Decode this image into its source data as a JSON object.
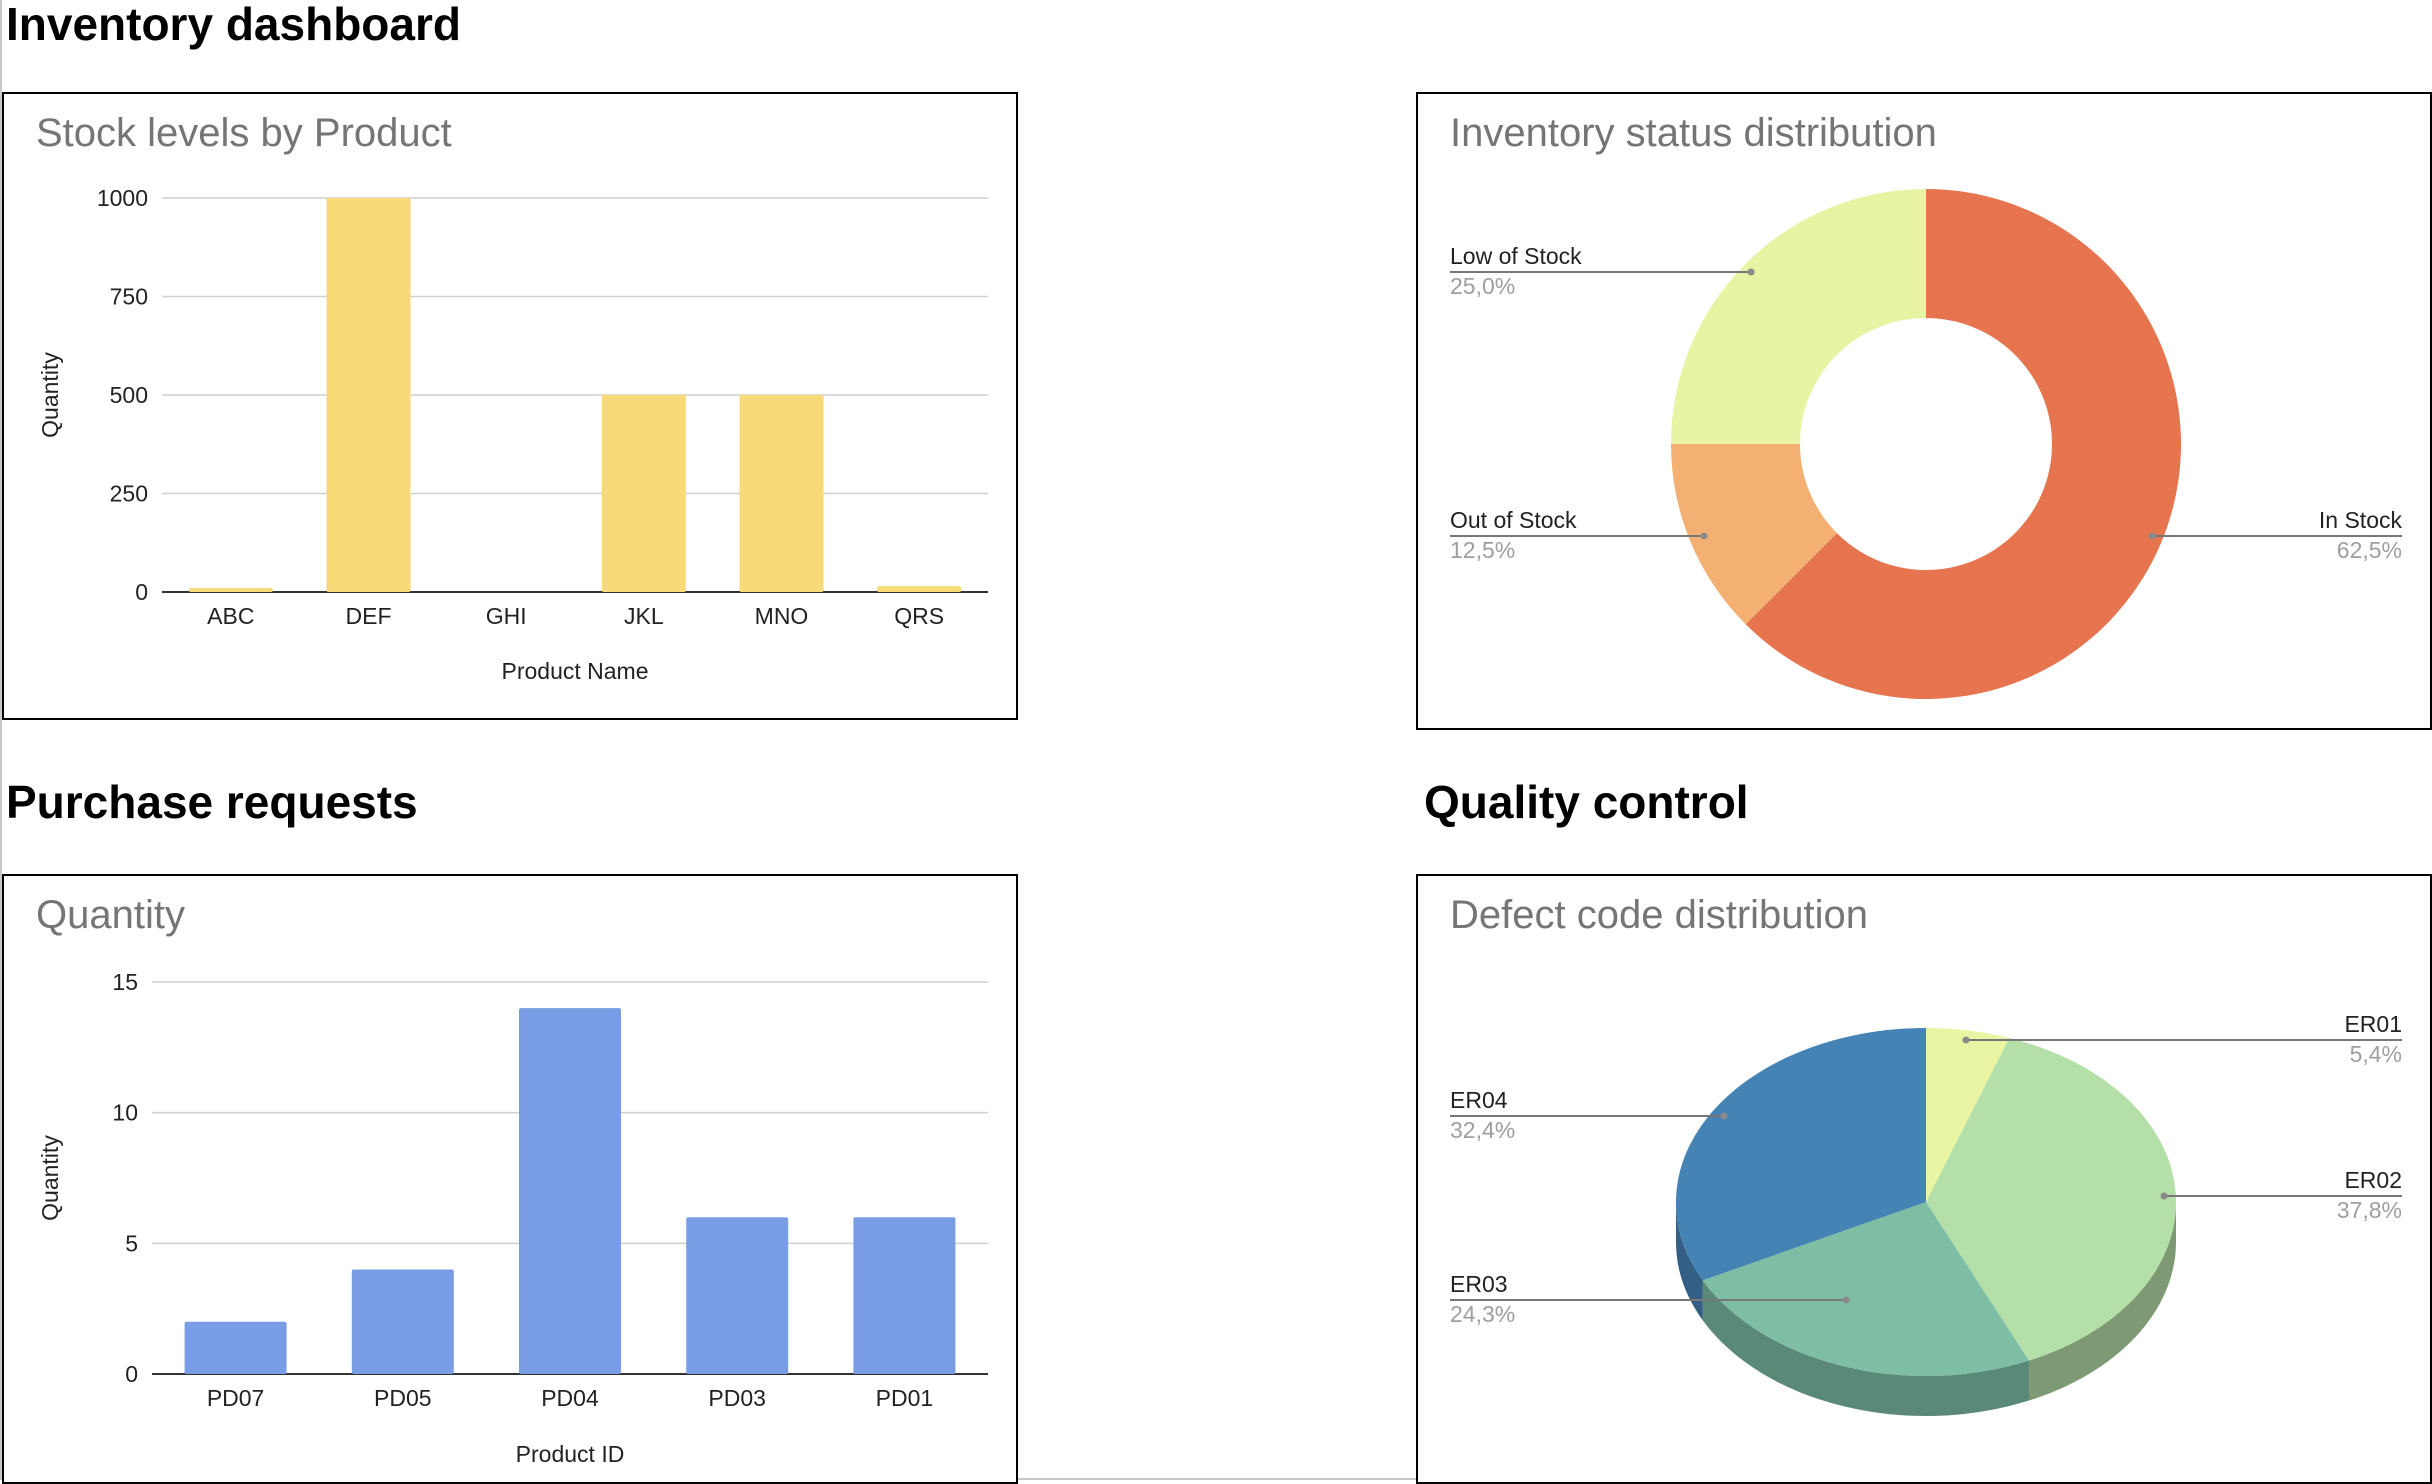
{
  "sections": {
    "inventory": "Inventory dashboard",
    "purchase": "Purchase requests",
    "quality": "Quality control"
  },
  "chart_data": [
    {
      "id": "stock",
      "type": "bar",
      "title": "Stock levels by Product",
      "xlabel": "Product Name",
      "ylabel": "Quantity",
      "categories": [
        "ABC",
        "DEF",
        "GHI",
        "JKL",
        "MNO",
        "QRS"
      ],
      "values": [
        10,
        1000,
        0,
        500,
        500,
        15
      ],
      "ylim": [
        0,
        1000
      ],
      "yticks": [
        0,
        250,
        500,
        750,
        1000
      ],
      "grid": true,
      "color": "#f9da78"
    },
    {
      "id": "status",
      "type": "pie",
      "donut": true,
      "title": "Inventory status distribution",
      "slices": [
        {
          "label": "In Stock",
          "value": 62.5,
          "pct": "62,5%",
          "color": "#e6754f"
        },
        {
          "label": "Out of Stock",
          "value": 12.5,
          "pct": "12,5%",
          "color": "#f3b072"
        },
        {
          "label": "Low of Stock",
          "value": 25.0,
          "pct": "25,0%",
          "color": "#e8f4a4"
        }
      ]
    },
    {
      "id": "purchase",
      "type": "bar",
      "title": "Quantity",
      "xlabel": "Product ID",
      "ylabel": "Quantity",
      "categories": [
        "PD07",
        "PD05",
        "PD04",
        "PD03",
        "PD01"
      ],
      "values": [
        2,
        4,
        14,
        6,
        6
      ],
      "ylim": [
        0,
        15
      ],
      "yticks": [
        0,
        5,
        10,
        15
      ],
      "grid": true,
      "color": "#789de4"
    },
    {
      "id": "defects",
      "type": "pie",
      "style": "3d",
      "title": "Defect code distribution",
      "slices": [
        {
          "label": "ER01",
          "value": 5.4,
          "pct": "5,4%",
          "color": "#eaf5a4",
          "side": "#b8c07e"
        },
        {
          "label": "ER02",
          "value": 37.8,
          "pct": "37,8%",
          "color": "#b5dfa8",
          "side": "#7e9a74"
        },
        {
          "label": "ER03",
          "value": 24.3,
          "pct": "24,3%",
          "color": "#7dbea5",
          "side": "#5a8978"
        },
        {
          "label": "ER04",
          "value": 32.4,
          "pct": "32,4%",
          "color": "#4583b5",
          "side": "#335f84"
        }
      ]
    }
  ]
}
